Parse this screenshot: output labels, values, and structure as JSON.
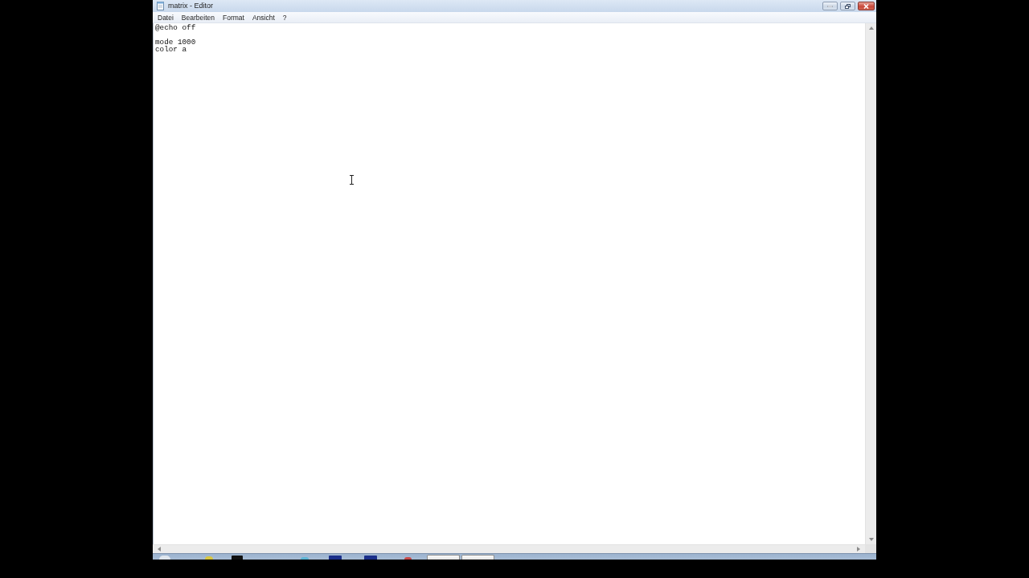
{
  "window": {
    "title": "matrix - Editor"
  },
  "menu": [
    "Datei",
    "Bearbeiten",
    "Format",
    "Ansicht",
    "?"
  ],
  "editor": {
    "value": "@echo off\n\nmode 1000\ncolor a"
  }
}
